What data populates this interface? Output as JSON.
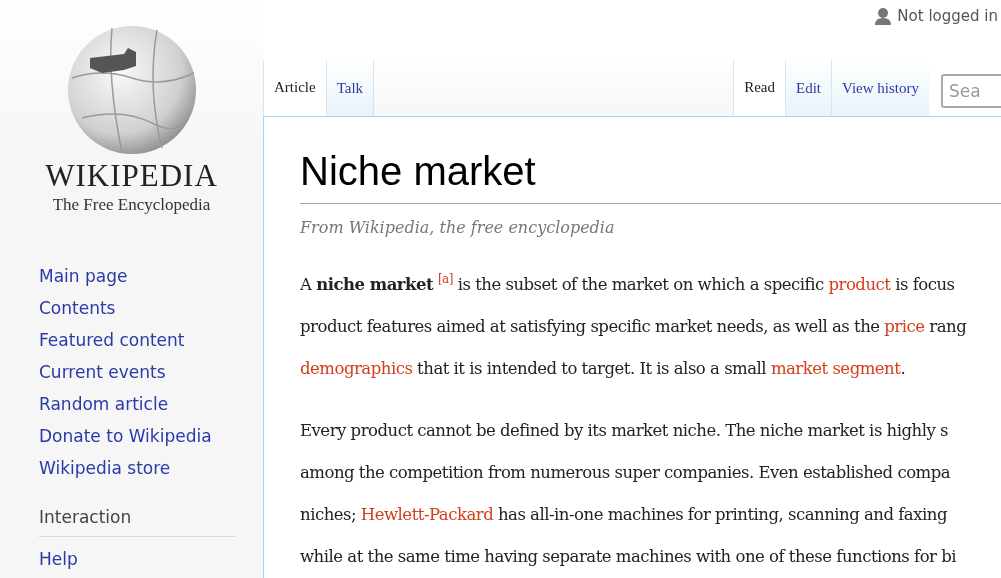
{
  "logo": {
    "wordmark": "WIKIPEDIA",
    "tagline": "The Free Encyclopedia"
  },
  "user": {
    "status": "Not logged in"
  },
  "tabs_left": [
    {
      "label": "Article",
      "selected": true
    },
    {
      "label": "Talk",
      "selected": false
    }
  ],
  "tabs_right": [
    {
      "label": "Read",
      "selected": true
    },
    {
      "label": "Edit",
      "selected": false
    },
    {
      "label": "View history",
      "selected": false
    }
  ],
  "search": {
    "placeholder": "Sea"
  },
  "sidebar": {
    "items": [
      "Main page",
      "Contents",
      "Featured content",
      "Current events",
      "Random article",
      "Donate to Wikipedia",
      "Wikipedia store"
    ],
    "sections": [
      {
        "heading": "Interaction",
        "items": [
          "Help"
        ]
      }
    ]
  },
  "article": {
    "title": "Niche market",
    "subtitle": "From Wikipedia, the free encyclopedia",
    "paragraphs": [
      [
        [
          {
            "kind": "text",
            "text": "A "
          },
          {
            "kind": "bold",
            "text": "niche market"
          },
          {
            "kind": "ref",
            "text": "[a]"
          },
          {
            "kind": "text",
            "text": " is the subset of the market on which a specific "
          },
          {
            "kind": "link",
            "text": "product"
          },
          {
            "kind": "text",
            "text": " is focus"
          }
        ],
        [
          {
            "kind": "text",
            "text": "product features aimed at satisfying specific market needs, as well as the "
          },
          {
            "kind": "link",
            "text": "price"
          },
          {
            "kind": "text",
            "text": " rang"
          }
        ],
        [
          {
            "kind": "link",
            "text": "demographics"
          },
          {
            "kind": "text",
            "text": " that it is intended to target. It is also a small "
          },
          {
            "kind": "link",
            "text": "market segment"
          },
          {
            "kind": "text",
            "text": "."
          }
        ]
      ],
      [
        [
          {
            "kind": "text",
            "text": "Every product cannot be defined by its market niche. The niche market is highly s"
          }
        ],
        [
          {
            "kind": "text",
            "text": "among the competition from numerous super companies. Even established compa"
          }
        ],
        [
          {
            "kind": "text",
            "text": "niches; "
          },
          {
            "kind": "link",
            "text": "Hewlett-Packard"
          },
          {
            "kind": "text",
            "text": " has all-in-one machines for printing, scanning and faxing"
          }
        ],
        [
          {
            "kind": "text",
            "text": "while at the same time having separate machines with one of these functions for bi"
          }
        ]
      ]
    ]
  }
}
